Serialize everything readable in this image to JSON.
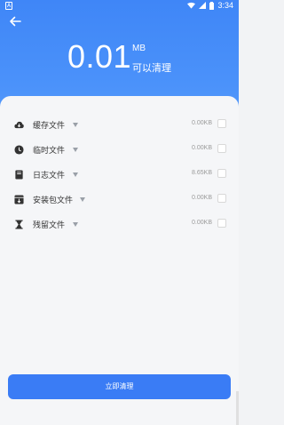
{
  "status_bar": {
    "time": "3:34",
    "left_icon": "A"
  },
  "header": {
    "size_value": "0.01",
    "size_unit": "MB",
    "subtitle": "可以清理"
  },
  "items": [
    {
      "label": "缓存文件",
      "size": "0.00KB",
      "icon": "cloud-download-icon"
    },
    {
      "label": "临时文件",
      "size": "0.00KB",
      "icon": "clock-icon"
    },
    {
      "label": "日志文件",
      "size": "8.65KB",
      "icon": "log-book-icon"
    },
    {
      "label": "安装包文件",
      "size": "0.00KB",
      "icon": "package-icon"
    },
    {
      "label": "残留文件",
      "size": "0.00KB",
      "icon": "hourglass-icon"
    }
  ],
  "action": {
    "clean_label": "立即清理"
  }
}
